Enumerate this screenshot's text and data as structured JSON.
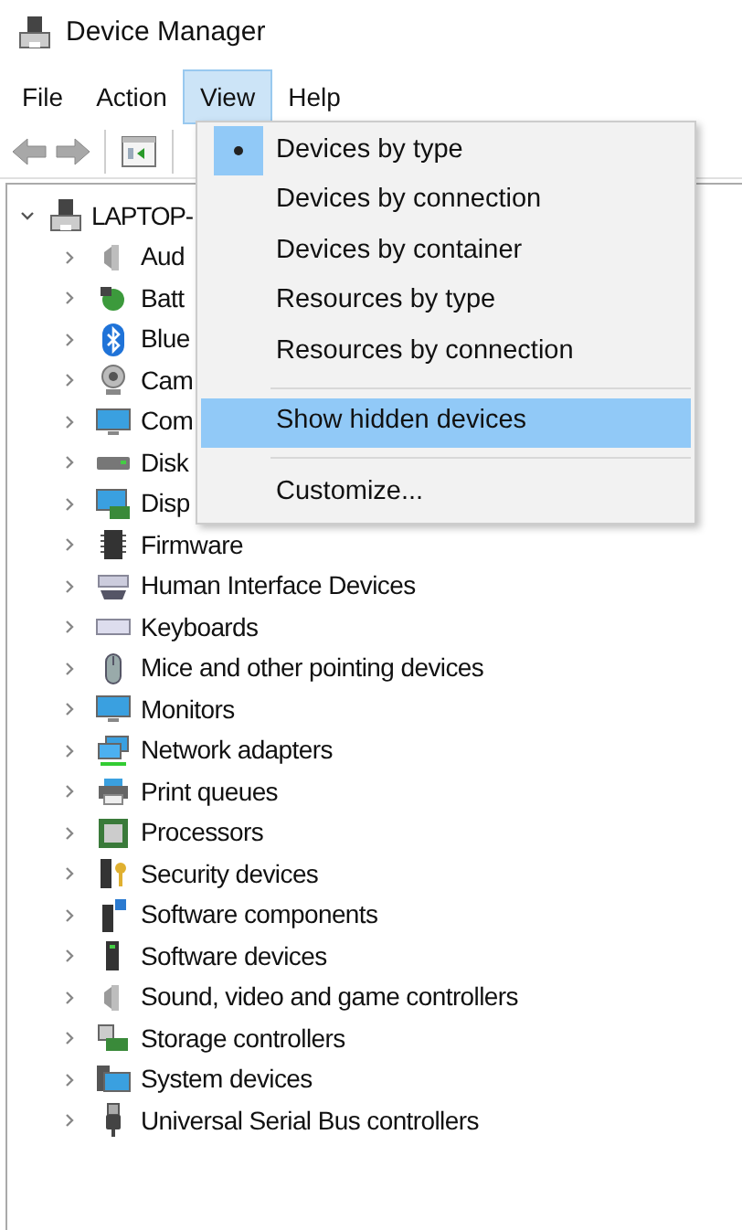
{
  "window": {
    "title": "Device Manager"
  },
  "menu_bar": [
    {
      "label": "File",
      "selected": false
    },
    {
      "label": "Action",
      "selected": false
    },
    {
      "label": "View",
      "selected": true
    },
    {
      "label": "Help",
      "selected": false
    }
  ],
  "toolbar": [
    {
      "kind": "back",
      "disabled": true
    },
    {
      "kind": "forward",
      "disabled": true
    },
    {
      "kind": "separator"
    },
    {
      "kind": "properties",
      "disabled": false
    },
    {
      "kind": "separator"
    }
  ],
  "tree": {
    "label": "LAPTOP-",
    "expanded": true,
    "children": [
      {
        "label": "Aud",
        "expanded": false
      },
      {
        "label": "Batt",
        "expanded": false
      },
      {
        "label": "Blue",
        "expanded": false
      },
      {
        "label": "Cam",
        "expanded": false
      },
      {
        "label": "Com",
        "expanded": false
      },
      {
        "label": "Disk",
        "expanded": false
      },
      {
        "label": "Disp",
        "expanded": false
      },
      {
        "label": "Firmware",
        "expanded": false
      },
      {
        "label": "Human Interface Devices",
        "expanded": false
      },
      {
        "label": "Keyboards",
        "expanded": false
      },
      {
        "label": "Mice and other pointing devices",
        "expanded": false
      },
      {
        "label": "Monitors",
        "expanded": false
      },
      {
        "label": "Network adapters",
        "expanded": false
      },
      {
        "label": "Print queues",
        "expanded": false
      },
      {
        "label": "Processors",
        "expanded": false
      },
      {
        "label": "Security devices",
        "expanded": false
      },
      {
        "label": "Software components",
        "expanded": false
      },
      {
        "label": "Software devices",
        "expanded": false
      },
      {
        "label": "Sound, video and game controllers",
        "expanded": false
      },
      {
        "label": "Storage controllers",
        "expanded": false
      },
      {
        "label": "System devices",
        "expanded": false
      },
      {
        "label": "Universal Serial Bus controllers",
        "expanded": false
      }
    ]
  },
  "view_menu": [
    {
      "kind": "radio",
      "label": "Devices by type",
      "selected": true,
      "highlighted": false
    },
    {
      "kind": "radio",
      "label": "Devices by connection",
      "selected": false,
      "highlighted": false
    },
    {
      "kind": "radio",
      "label": "Devices by container",
      "selected": false,
      "highlighted": false
    },
    {
      "kind": "radio",
      "label": "Resources by type",
      "selected": false,
      "highlighted": false
    },
    {
      "kind": "radio",
      "label": "Resources by connection",
      "selected": false,
      "highlighted": false
    },
    {
      "kind": "separator"
    },
    {
      "kind": "item",
      "label": "Show hidden devices",
      "highlighted": true
    },
    {
      "kind": "separator"
    },
    {
      "kind": "item",
      "label": "Customize...",
      "highlighted": false
    }
  ]
}
